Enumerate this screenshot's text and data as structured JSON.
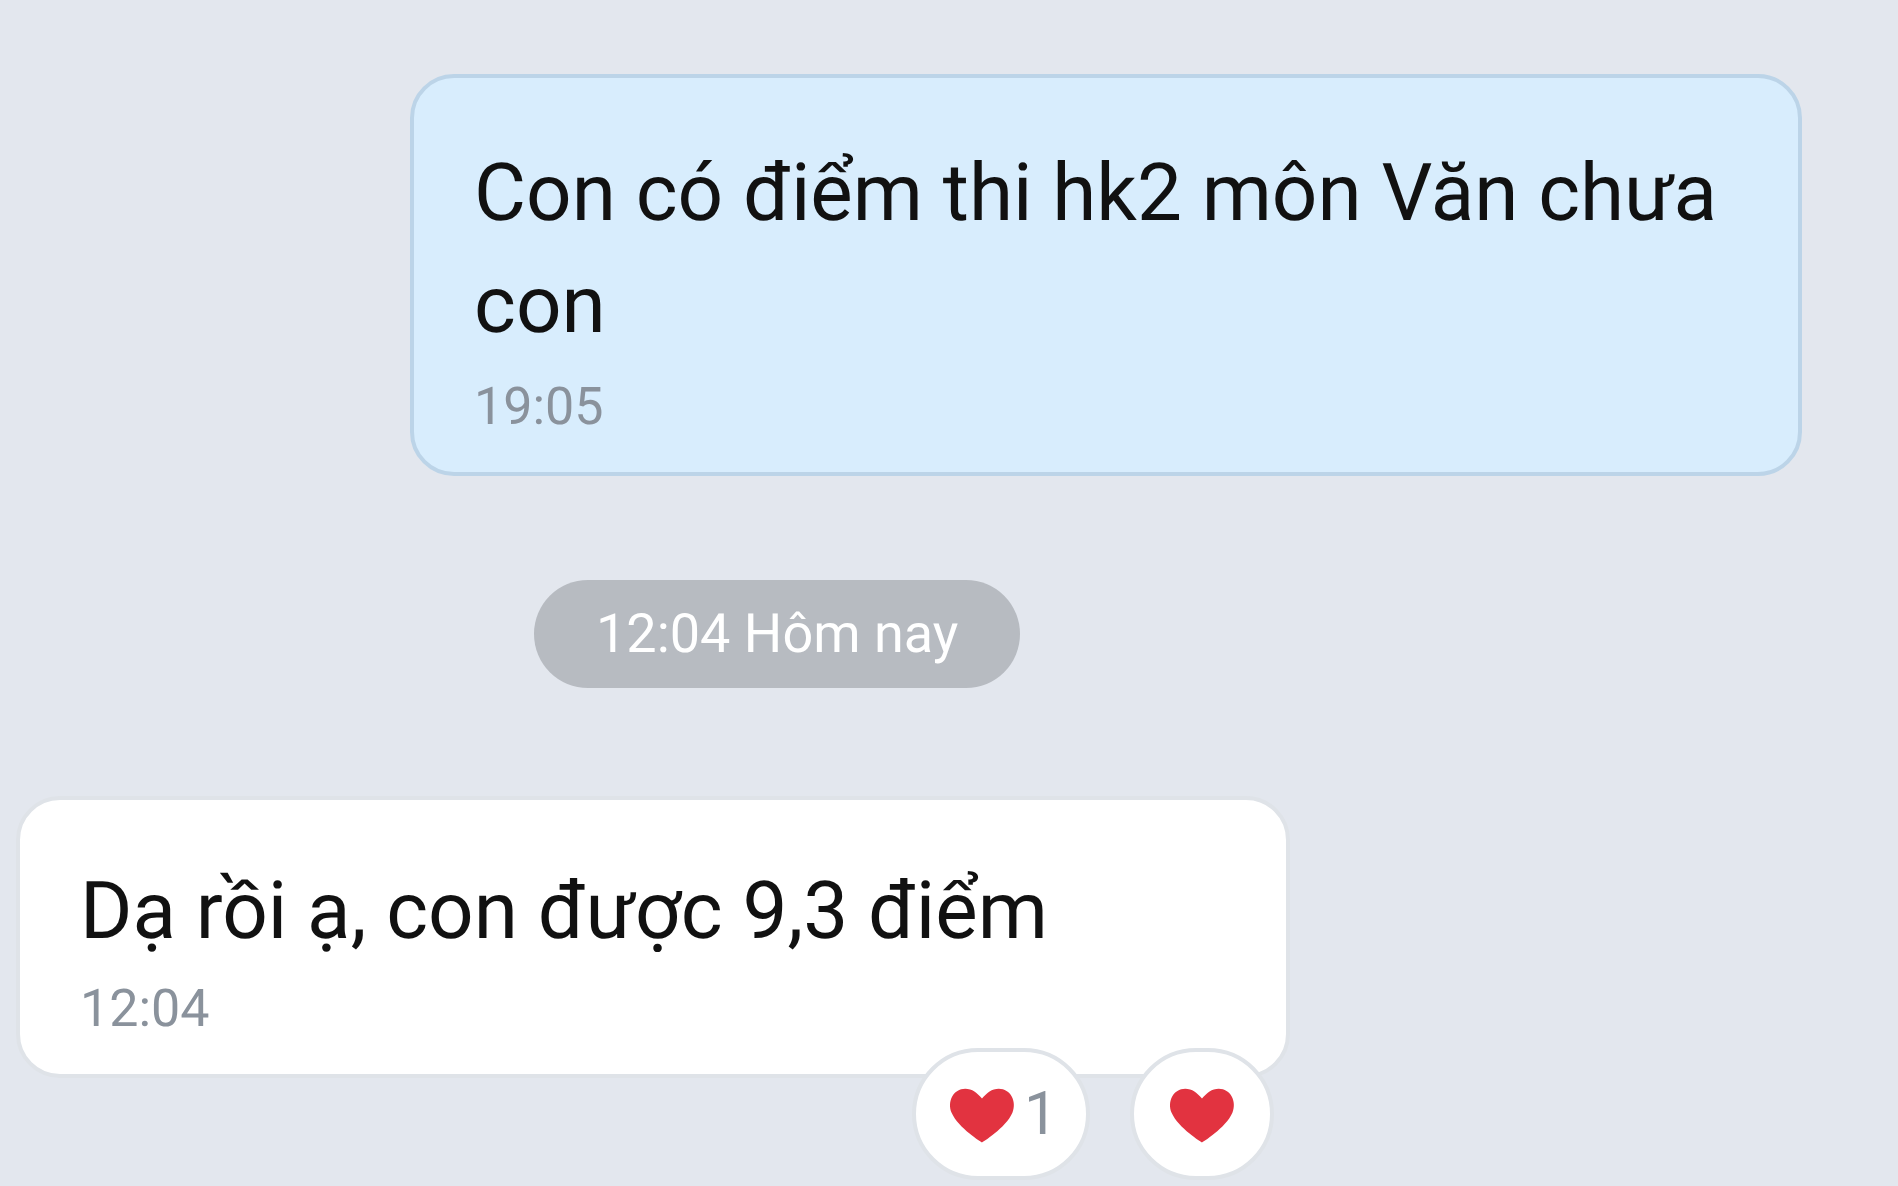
{
  "messages": [
    {
      "kind": "outgoing",
      "text": "Con có điểm thi hk2 môn Văn chưa con",
      "time": "19:05"
    },
    {
      "kind": "divider",
      "text": "12:04 Hôm nay"
    },
    {
      "kind": "incoming",
      "text": "Dạ rồi ạ, con được 9,3 điểm",
      "time": "12:04",
      "reactions": [
        {
          "kind": "count",
          "count": "1"
        },
        {
          "kind": "add"
        }
      ]
    }
  ]
}
